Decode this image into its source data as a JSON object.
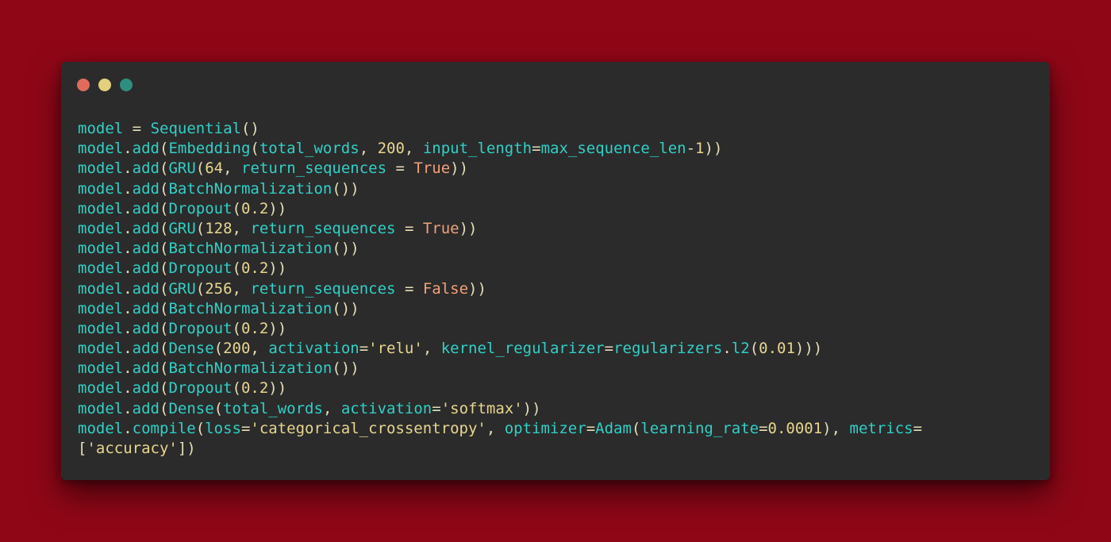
{
  "window": {
    "controls": [
      "close",
      "minimize",
      "zoom"
    ]
  },
  "code": {
    "lines": [
      "model = Sequential()",
      "model.add(Embedding(total_words, 200, input_length=max_sequence_len-1))",
      "model.add(GRU(64, return_sequences = True))",
      "model.add(BatchNormalization())",
      "model.add(Dropout(0.2))",
      "model.add(GRU(128, return_sequences = True))",
      "model.add(BatchNormalization())",
      "model.add(Dropout(0.2))",
      "model.add(GRU(256, return_sequences = False))",
      "model.add(BatchNormalization())",
      "model.add(Dropout(0.2))",
      "model.add(Dense(200, activation='relu', kernel_regularizer=regularizers.l2(0.01)))",
      "model.add(BatchNormalization())",
      "model.add(Dropout(0.2))",
      "model.add(Dense(total_words, activation='softmax'))",
      "model.compile(loss='categorical_crossentropy', optimizer=Adam(learning_rate=0.0001), metrics=",
      "['accuracy'])"
    ]
  },
  "colors": {
    "background": "#8f0717",
    "window": "#2b2b2b",
    "close": "#e06b5b",
    "minimize": "#e3cf7f",
    "zoom": "#2f8f7e",
    "identifier": "#2fd1c8",
    "number_string": "#e8d68f",
    "keyword": "#f0a27a"
  }
}
